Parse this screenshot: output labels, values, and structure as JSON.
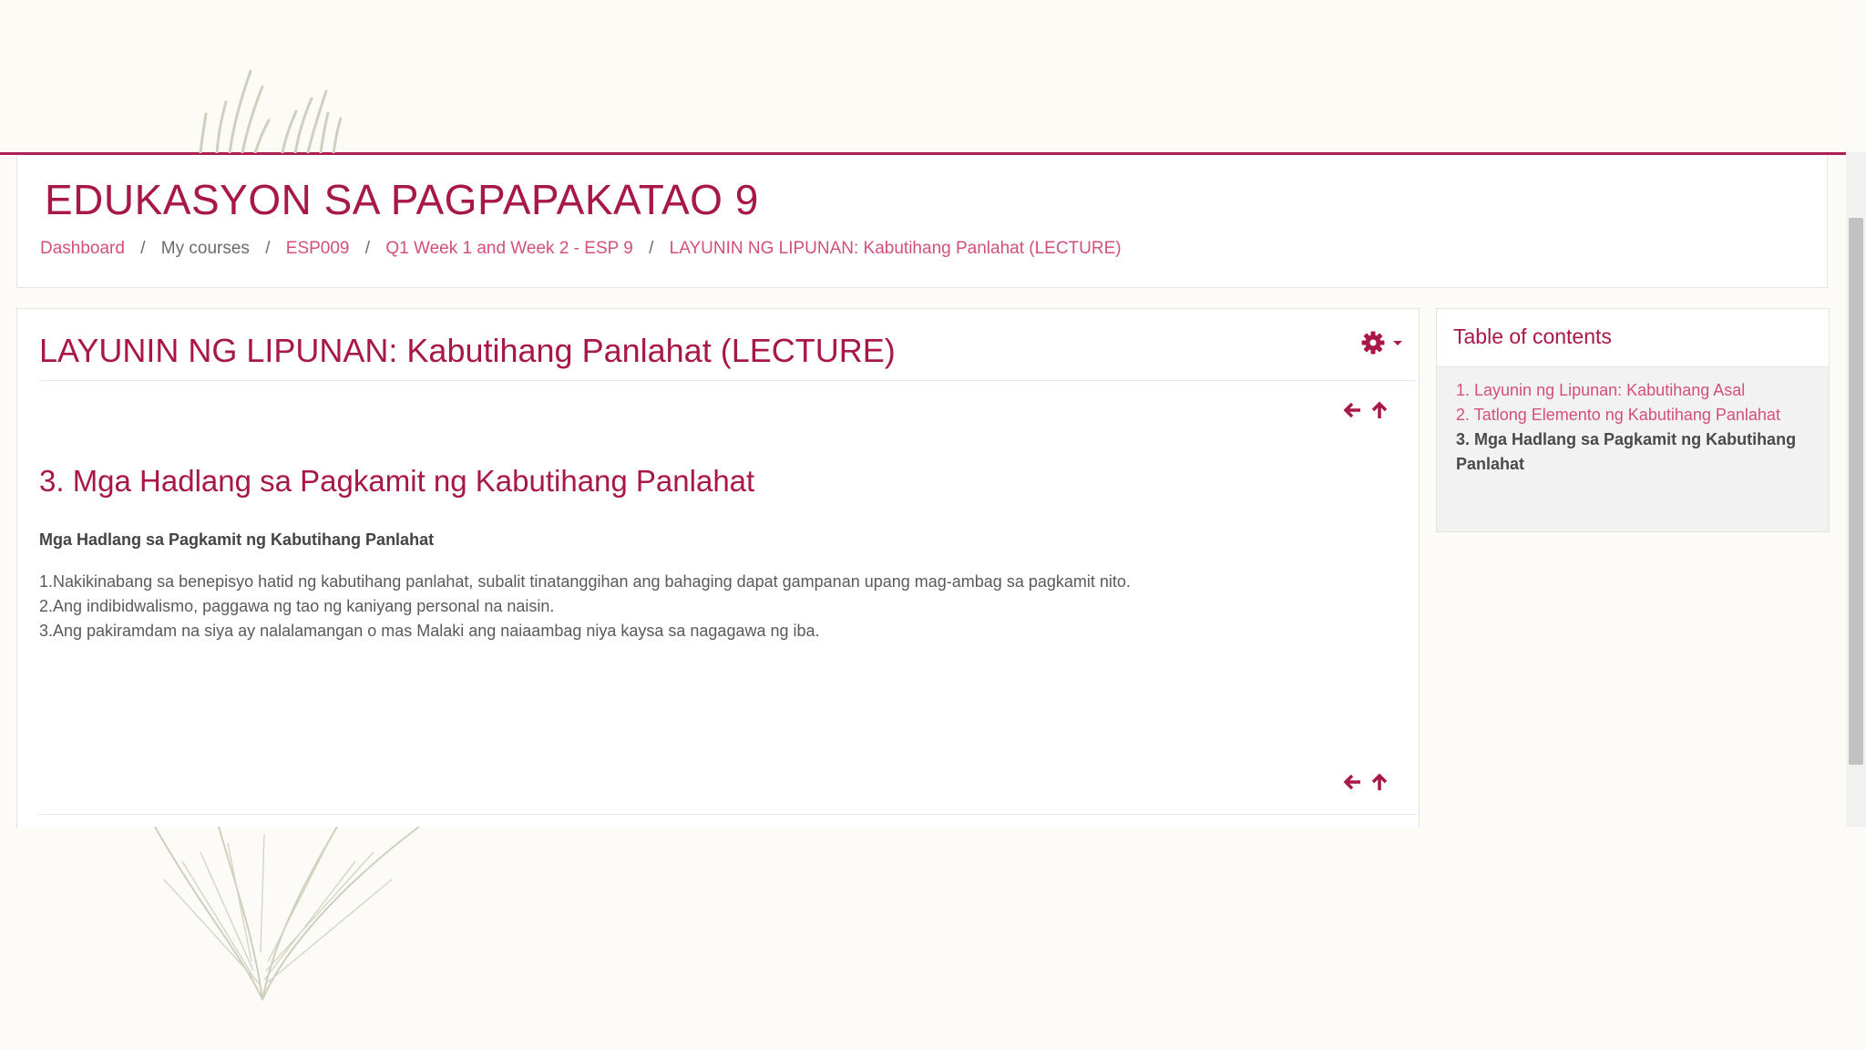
{
  "course": {
    "title": "EDUKASYON SA PAGPAPAKATAO 9"
  },
  "breadcrumb": [
    {
      "label": "Dashboard",
      "link": true
    },
    {
      "label": "My courses",
      "link": false
    },
    {
      "label": "ESP009",
      "link": true
    },
    {
      "label": "Q1 Week 1 and Week 2 - ESP 9",
      "link": true
    },
    {
      "label": "LAYUNIN NG LIPUNAN: Kabutihang Panlahat (LECTURE)",
      "link": true
    }
  ],
  "breadcrumb_separator": "/",
  "lesson": {
    "title": "LAYUNIN NG LIPUNAN: Kabutihang Panlahat (LECTURE)",
    "section_heading": "3. Mga Hadlang sa Pagkamit ng Kabutihang Panlahat",
    "sub_heading": "Mga Hadlang sa Pagkamit ng Kabutihang Panlahat",
    "points": [
      "1.Nakikinabang sa benepisyo hatid ng kabutihang panlahat, subalit tinatanggihan ang bahaging dapat gampanan upang mag-ambag sa pagkamit nito.",
      "2.Ang indibidwalismo, paggawa ng tao ng kaniyang personal na naisin.",
      "3.Ang pakiramdam na siya ay nalalamangan o mas Malaki ang naiaambag niya kaysa sa nagagawa ng iba."
    ]
  },
  "toc": {
    "title": "Table of contents",
    "items": [
      {
        "label": "1. Layunin ng Lipunan: Kabutihang Asal",
        "active": false
      },
      {
        "label": "2. Tatlong Elemento ng Kabutihang Panlahat",
        "active": false
      },
      {
        "label": "3. Mga Hadlang sa Pagkamit ng Kabutihang Panlahat",
        "active": true
      }
    ]
  },
  "icons": {
    "settings": "gear-icon",
    "previous": "arrow-left-icon",
    "up": "arrow-up-icon"
  },
  "colors": {
    "brand": "#a8174a",
    "link": "#d34f7d",
    "banner_rule": "#b01d52"
  }
}
